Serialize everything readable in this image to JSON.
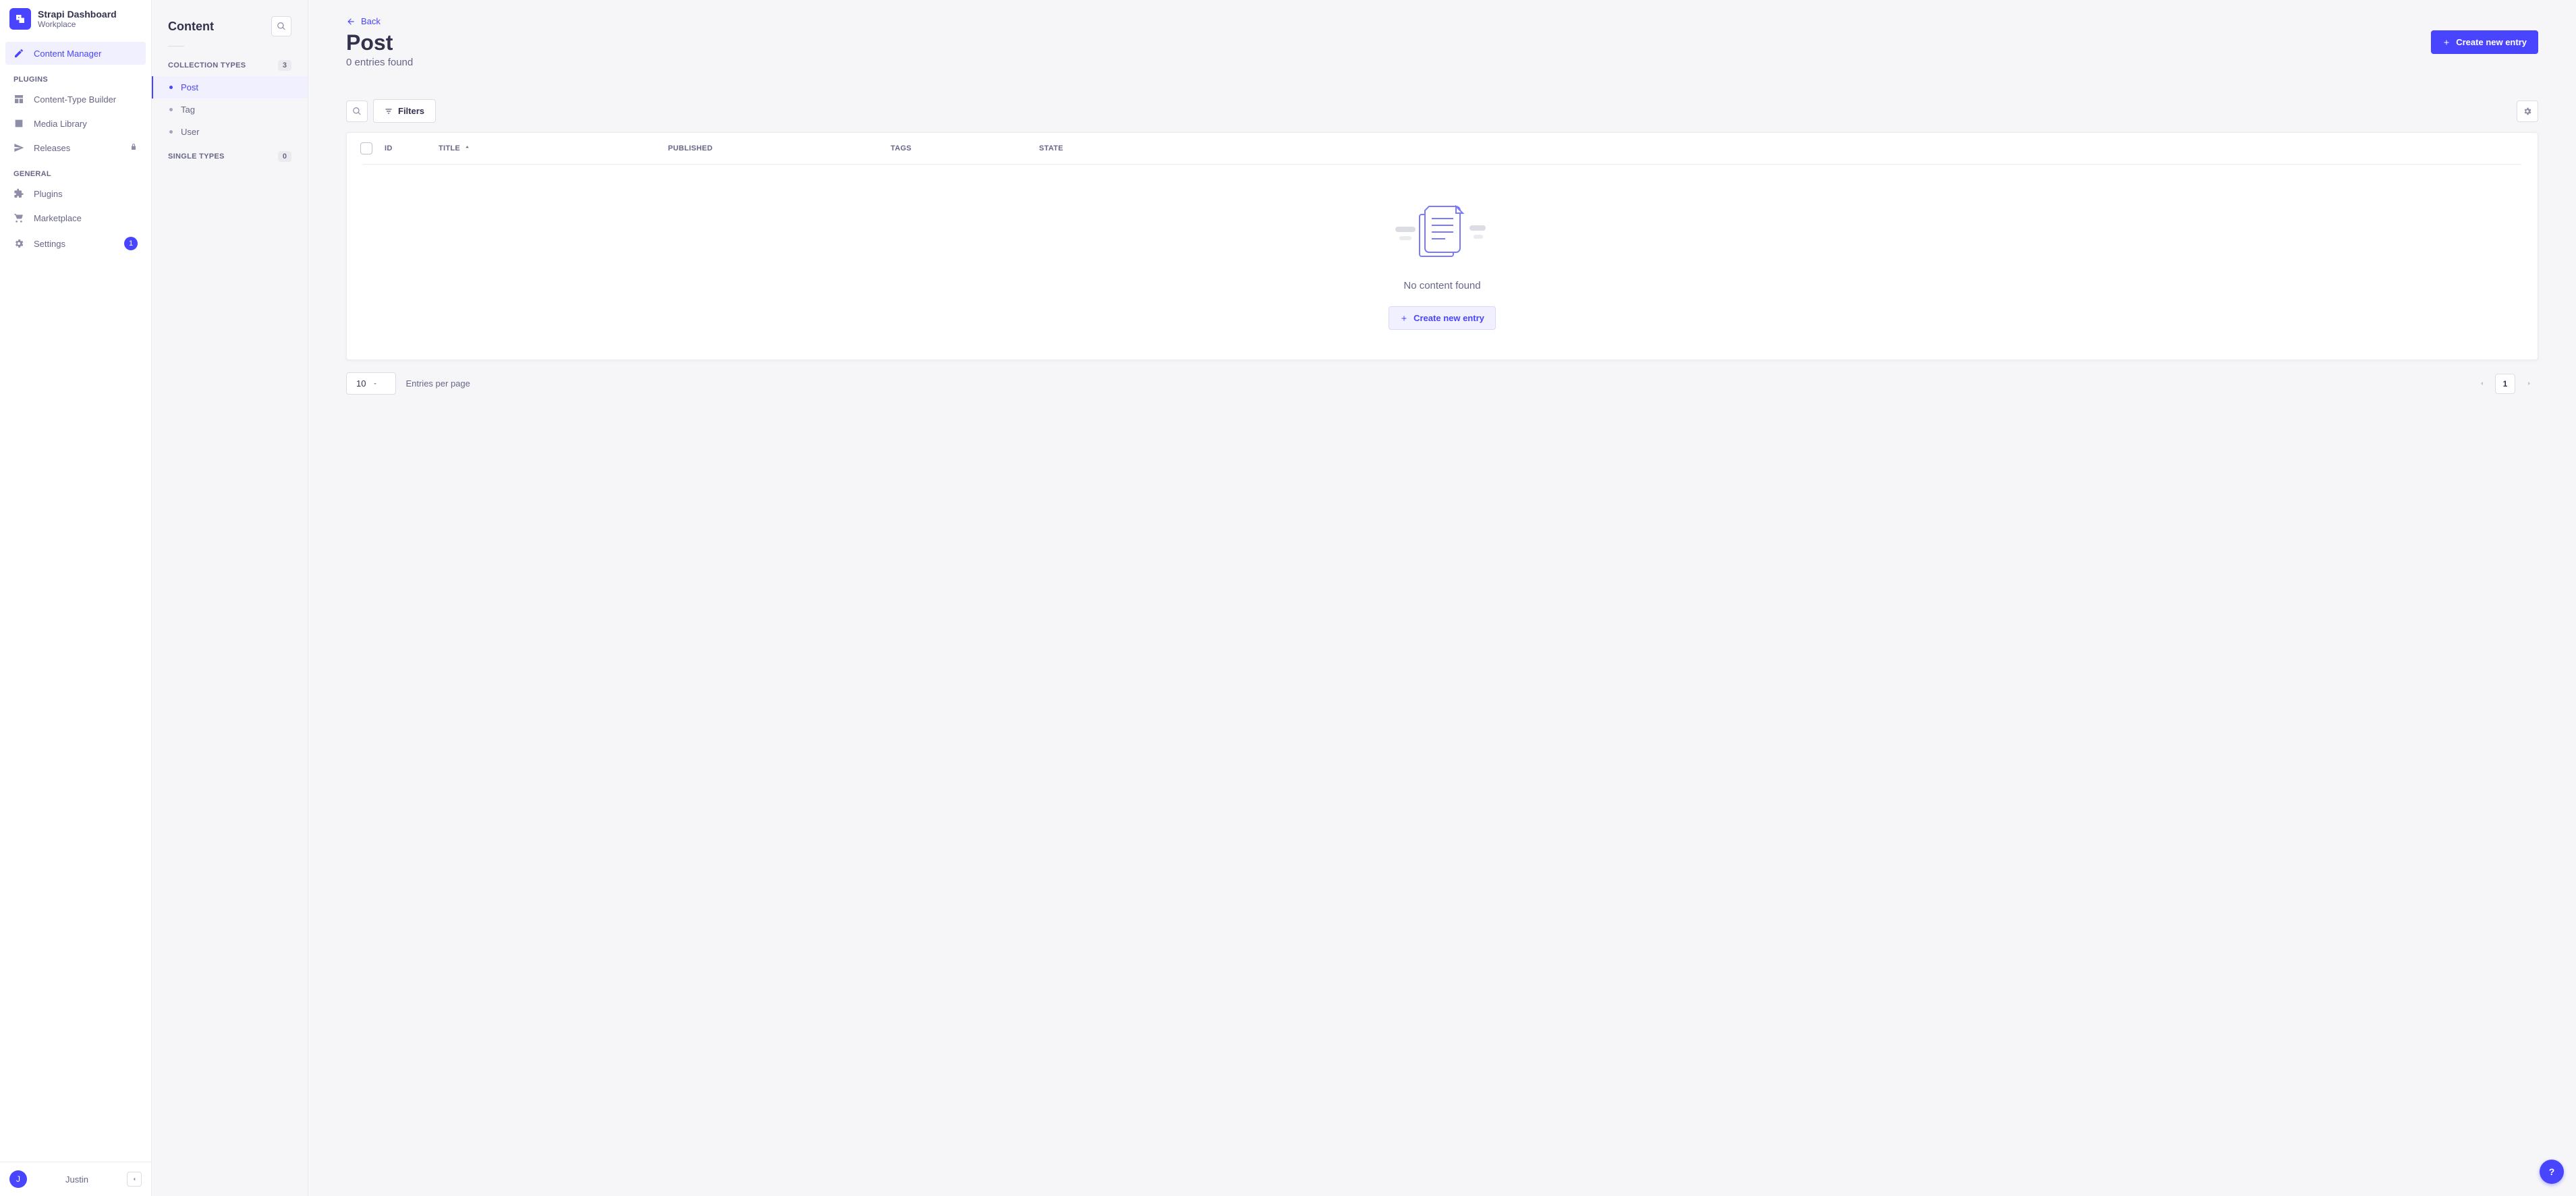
{
  "brand": {
    "title": "Strapi Dashboard",
    "subtitle": "Workplace"
  },
  "nav": {
    "content_manager": "Content Manager",
    "plugins_label": "PLUGINS",
    "content_type_builder": "Content-Type Builder",
    "media_library": "Media Library",
    "releases": "Releases",
    "general_label": "GENERAL",
    "plugins": "Plugins",
    "marketplace": "Marketplace",
    "settings": "Settings",
    "settings_badge": "1"
  },
  "user": {
    "initial": "J",
    "name": "Justin"
  },
  "sidebar2": {
    "title": "Content",
    "collection_label": "COLLECTION TYPES",
    "collection_count": "3",
    "items": [
      {
        "label": "Post",
        "active": true
      },
      {
        "label": "Tag",
        "active": false
      },
      {
        "label": "User",
        "active": false
      }
    ],
    "single_label": "SINGLE TYPES",
    "single_count": "0"
  },
  "page": {
    "back": "Back",
    "title": "Post",
    "subtitle": "0 entries found",
    "create_btn": "Create new entry",
    "filters": "Filters"
  },
  "table": {
    "cols": {
      "id": "ID",
      "title": "TITLE",
      "published": "PUBLISHED",
      "tags": "TAGS",
      "state": "STATE"
    },
    "empty_msg": "No content found",
    "empty_btn": "Create new entry"
  },
  "pagination": {
    "page_size": "10",
    "epp": "Entries per page",
    "current": "1"
  },
  "fab": "?"
}
